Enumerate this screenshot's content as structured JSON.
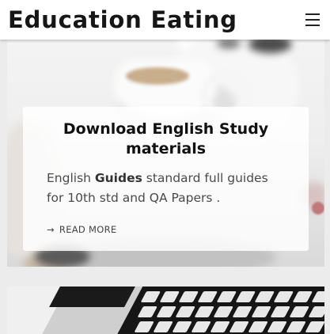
{
  "header": {
    "site_title": "Education Eating",
    "menu_icon": "hamburger-menu-icon"
  },
  "posts": [
    {
      "title": "Download English Study materials",
      "excerpt_parts": [
        "English ",
        "Guides",
        " standard full guides for 10th std and QA Papers ."
      ],
      "read_more_arrow": "→",
      "read_more": "Read More",
      "image": "coffee-cup-table-photo"
    },
    {
      "image": "laptop-keyboard-photo"
    }
  ]
}
